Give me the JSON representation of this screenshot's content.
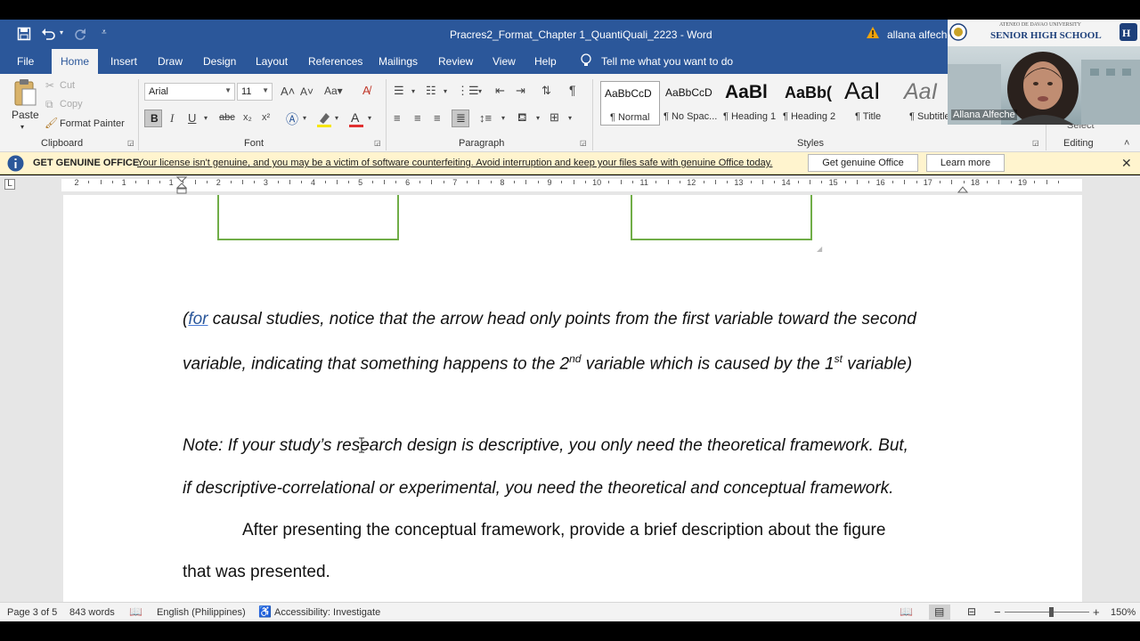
{
  "window": {
    "title": "Pracres2_Format_Chapter 1_QuantiQuali_2223  -  Word",
    "user": "allana alfeche"
  },
  "tabs": [
    "File",
    "Home",
    "Insert",
    "Draw",
    "Design",
    "Layout",
    "References",
    "Mailings",
    "Review",
    "View",
    "Help"
  ],
  "active_tab": "Home",
  "tell_me": "Tell me what you want to do",
  "clipboard": {
    "paste": "Paste",
    "cut": "Cut",
    "copy": "Copy",
    "format_painter": "Format Painter",
    "label": "Clipboard"
  },
  "font": {
    "name": "Arial",
    "size": "11",
    "label": "Font"
  },
  "paragraph": {
    "label": "Paragraph"
  },
  "styles": {
    "label": "Styles",
    "items": [
      {
        "sample": "AaBbCcD",
        "name": "¶ Normal"
      },
      {
        "sample": "AaBbCcD",
        "name": "¶ No Spac..."
      },
      {
        "sample": "AaBl",
        "name": "¶ Heading 1"
      },
      {
        "sample": "AaBb(",
        "name": "¶ Heading 2"
      },
      {
        "sample": "AaI",
        "name": "¶ Title"
      },
      {
        "sample": "AaI",
        "name": "¶ Subtitle"
      }
    ]
  },
  "editing": {
    "label": "Editing",
    "select": "Select"
  },
  "genuine": {
    "title": "GET GENUINE OFFICE",
    "message": "Your license isn't genuine, and you may be a victim of software counterfeiting. Avoid interruption and keep your files safe with genuine Office today.",
    "get_button": "Get genuine Office",
    "learn_button": "Learn more"
  },
  "ruler": {
    "numbers": [
      "2",
      "1",
      "1",
      "2",
      "3",
      "4",
      "5",
      "6",
      "7",
      "8",
      "9",
      "10",
      "11",
      "12",
      "13",
      "14",
      "15",
      "16",
      "17",
      "18",
      "19"
    ]
  },
  "document": {
    "line1_pre": "(",
    "line1_for": "for",
    "line1_post": " causal studies, notice that the arrow head only points from the first variable toward the second",
    "line2_a": "variable, indicating that something happens to the 2",
    "line2_sup1": "nd",
    "line2_b": " variable which is caused by the 1",
    "line2_sup2": "st",
    "line2_c": " variable)",
    "note1": "Note: If your study’s research design is descriptive, you only need the theoretical framework. But,",
    "note2": "if descriptive-correlational or experimental, you need the theoretical and conceptual framework.",
    "para1": "After presenting the conceptual framework, provide a brief description about the figure",
    "para2": "that was presented."
  },
  "status": {
    "page": "Page 3 of 5",
    "words": "843 words",
    "language": "English (Philippines)",
    "accessibility": "Accessibility: Investigate",
    "zoom": "150%",
    "zoom_level_percent": 150
  },
  "webcam": {
    "school_top": "ATENEO DE DAVAO UNIVERSITY",
    "school": "SENIOR HIGH SCHOOL",
    "name": "Allana Alfeche"
  },
  "colors": {
    "word_blue": "#2b579a",
    "frame_green": "#70ad47",
    "banner": "#fff4ce"
  }
}
